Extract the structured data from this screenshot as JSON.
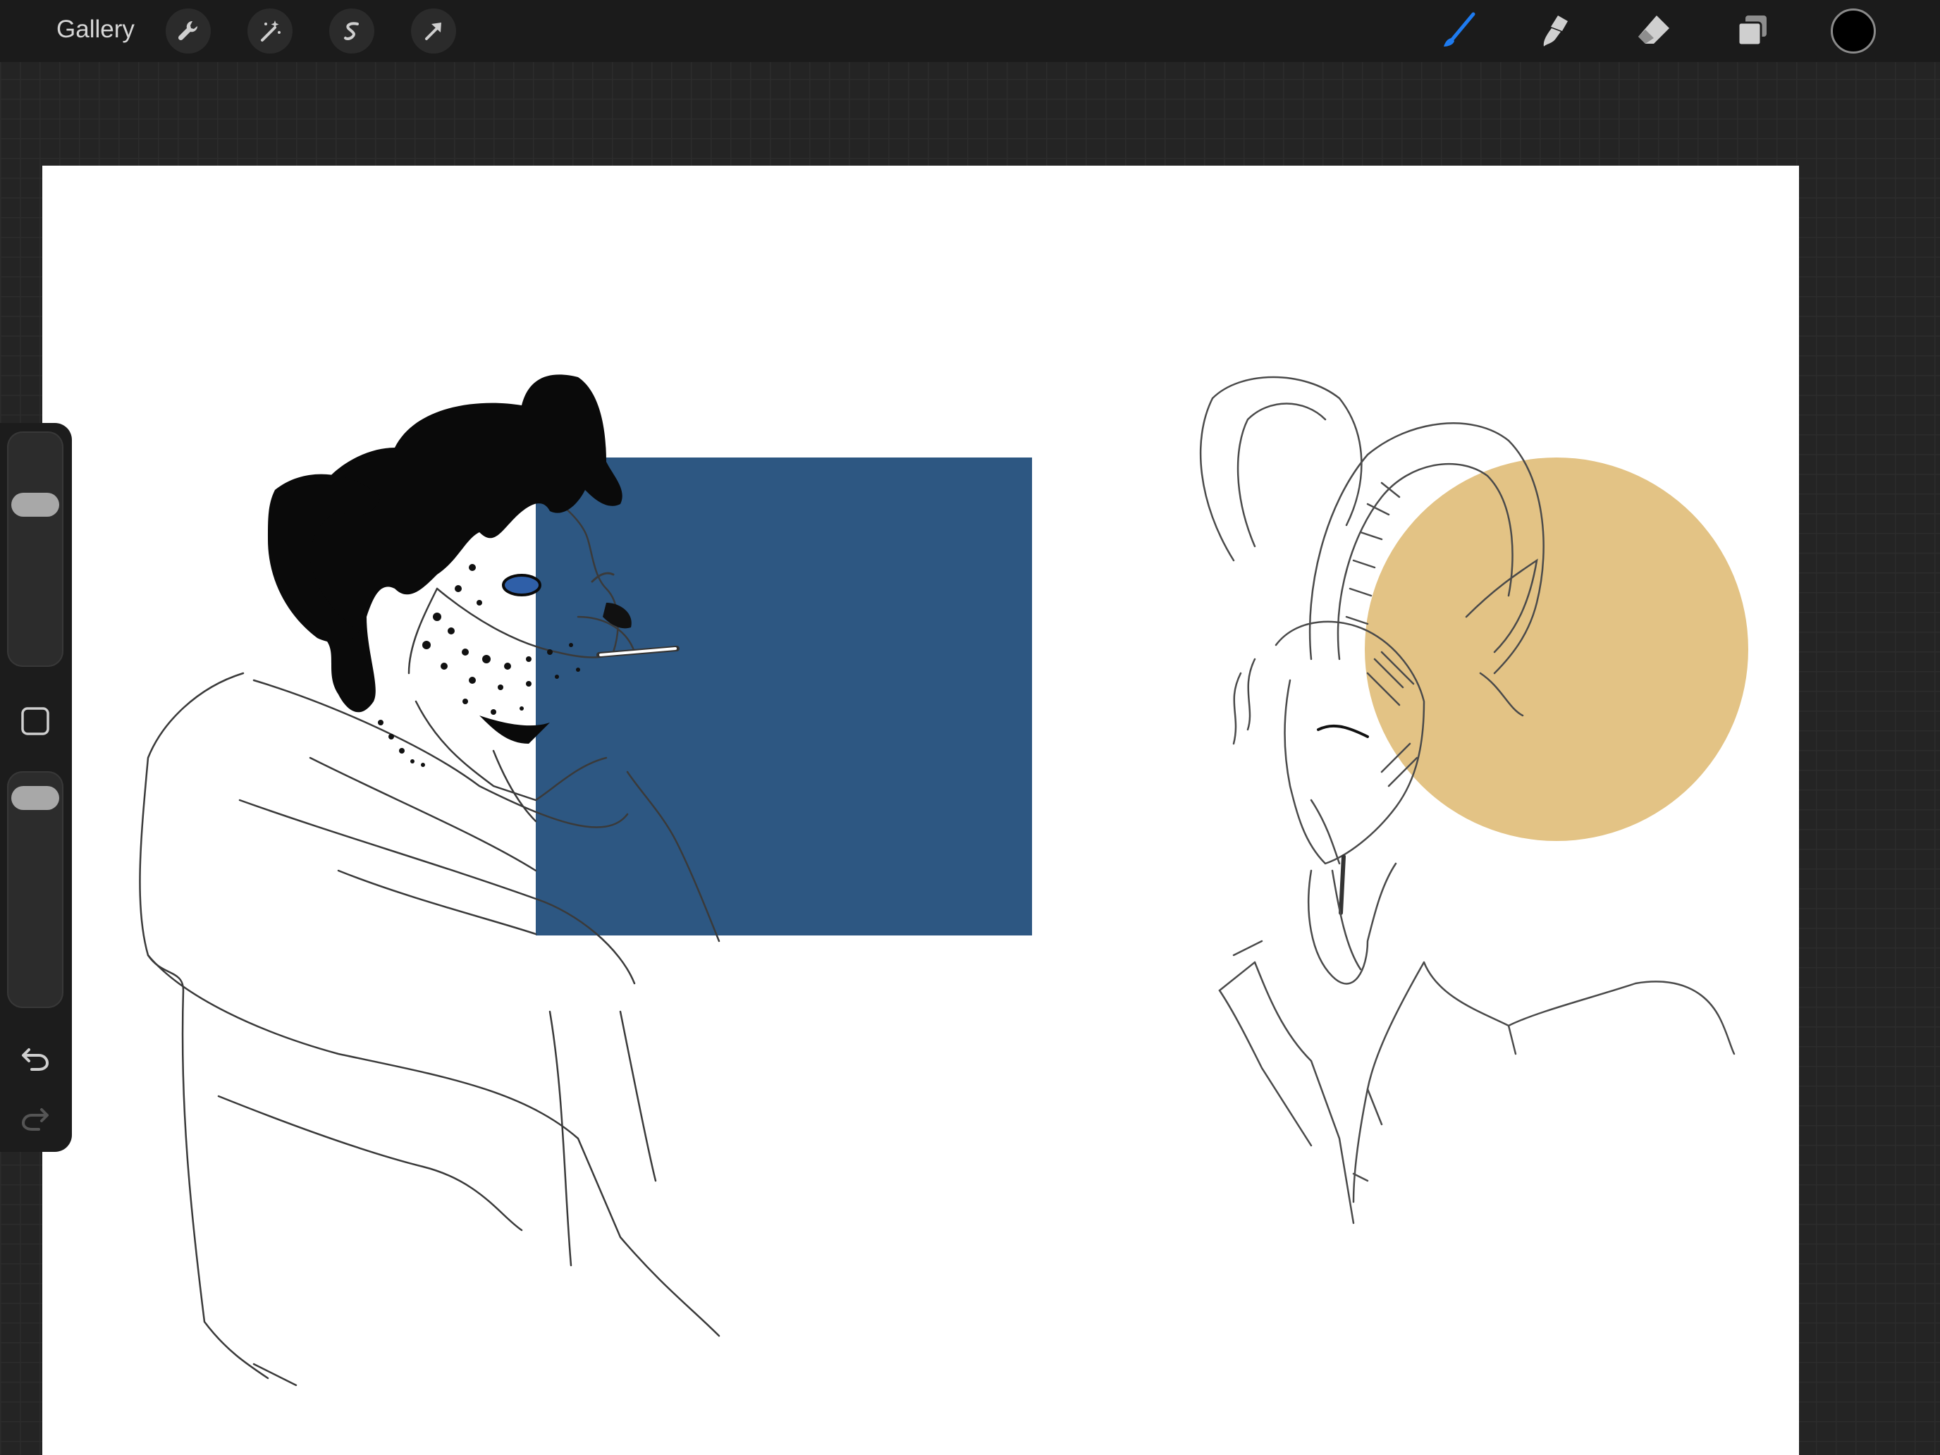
{
  "topbar": {
    "gallery_label": "Gallery",
    "left_tools": [
      "wrench-icon",
      "magic-wand-icon",
      "selection-s-icon",
      "transform-arrow-icon"
    ],
    "right_tools": [
      "brush-icon",
      "smudge-icon",
      "eraser-icon",
      "layers-icon"
    ],
    "active_tool": "brush",
    "current_color": "#000000",
    "accent_color": "#1e7bf0"
  },
  "sidebar": {
    "brush_size_level": 0.73,
    "opacity_level": 0.95,
    "modify_button": "square-modify-icon",
    "undo": "undo-icon",
    "redo": "redo-icon"
  },
  "canvas": {
    "background": "#ffffff",
    "blue_rectangle_color": "#2d5782",
    "gold_circle_color": "#e3c385",
    "artwork": [
      "leopard-character-sketch",
      "goat-character-sketch"
    ]
  }
}
